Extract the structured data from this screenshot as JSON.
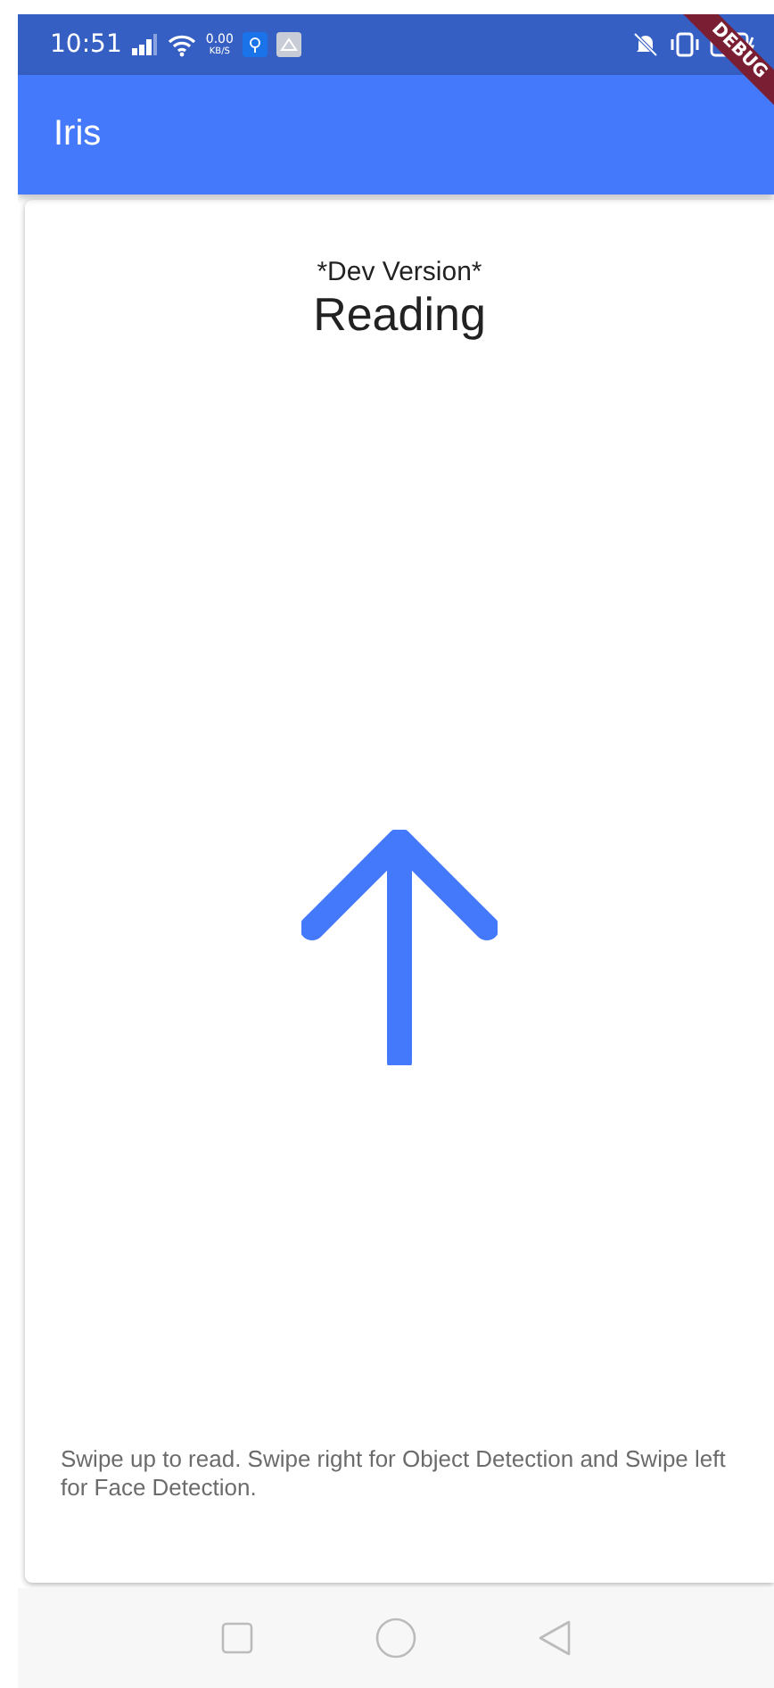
{
  "status_bar": {
    "time": "10:51",
    "speed_value": "0.00",
    "speed_unit": "KB/S"
  },
  "debug_banner": "DEBUG",
  "app_bar": {
    "title": "Iris"
  },
  "card": {
    "subtitle": "*Dev Version*",
    "title": "Reading",
    "hint": "Swipe up to read. Swipe right for Object Detection and Swipe left for Face Detection."
  }
}
